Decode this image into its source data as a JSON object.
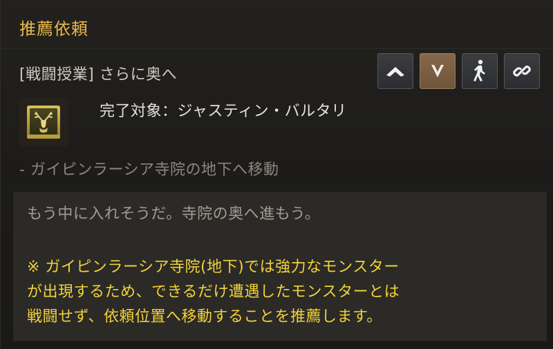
{
  "window": {
    "title": "推薦依頼"
  },
  "quest": {
    "name": "[戦闘授業] さらに奥へ",
    "icon": "stag-book-icon",
    "completion_target": "完了対象：ジャスティン・バルタリ",
    "objective": "- ガイピンラーシア寺院の地下へ移動"
  },
  "buttons": {
    "up": "chevron-up-icon",
    "down": "chevron-down-icon",
    "auto_walk": "walking-person-icon",
    "link": "chain-link-icon"
  },
  "description": {
    "text": "もう中に入れそうだ。寺院の奥へ進もう。",
    "notice_lines": [
      "※ ガイピンラーシア寺院(地下)では強力なモンスター",
      "が出現するため、できるだけ遭遇したモンスターとは",
      "戦闘せず、依頼位置へ移動することを推薦します。"
    ]
  },
  "colors": {
    "title": "#e9b84a",
    "notice": "#f1d23a",
    "active_button": "#7a5e42"
  }
}
